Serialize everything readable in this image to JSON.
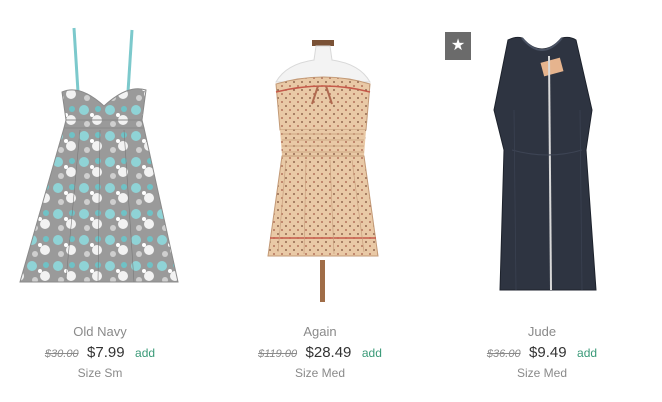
{
  "products": [
    {
      "brand": "Old Navy",
      "original_price": "$30.00",
      "price": "$7.99",
      "add_label": "add",
      "size": "Size Sm"
    },
    {
      "brand": "Again",
      "original_price": "$119.00",
      "price": "$28.49",
      "add_label": "add",
      "size": "Size Med"
    },
    {
      "brand": "Jude",
      "original_price": "$36.00",
      "price": "$9.49",
      "add_label": "add",
      "size": "Size Med"
    }
  ],
  "badge": {
    "icon": "star-icon",
    "glyph": "★"
  },
  "colors": {
    "add_link": "#3a9a78",
    "muted_text": "#8a8a8a",
    "price_text": "#333333",
    "badge_bg": "#6b6b6b"
  }
}
